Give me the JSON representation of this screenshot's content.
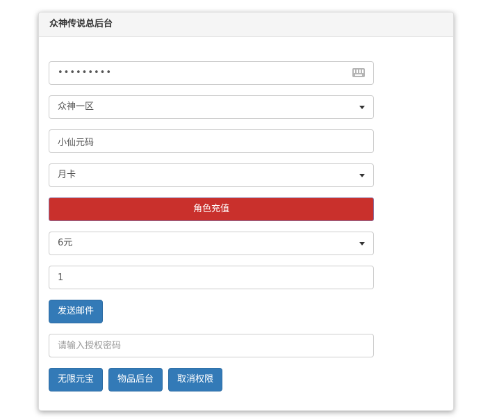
{
  "panel": {
    "title": "众神传说总后台"
  },
  "form": {
    "password_value": "•••••••••",
    "server_select": "众神一区",
    "item_code_value": "小仙元码",
    "card_select": "月卡",
    "recharge_bar_label": "角色充值",
    "amount_select": "6元",
    "quantity_value": "1",
    "send_mail_label": "发送邮件",
    "auth_password_placeholder": "请输入授权密码",
    "unlimited_ingot_label": "无限元宝",
    "item_backend_label": "物品后台",
    "revoke_permission_label": "取消权限"
  },
  "icons": {
    "keyboard": "keyboard-icon",
    "dropdown": "chevron-down-icon"
  },
  "colors": {
    "primary": "#337ab7",
    "danger": "#c9302c"
  }
}
